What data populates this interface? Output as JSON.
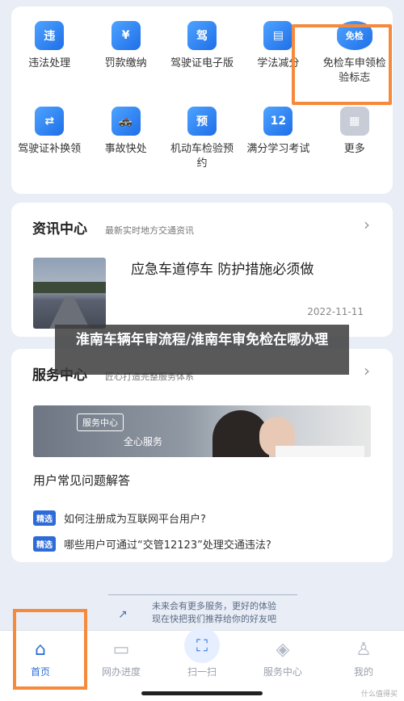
{
  "grid": {
    "items": [
      {
        "label": "违法处理",
        "icon": "violation-icon",
        "glyph": "违"
      },
      {
        "label": "罚款缴纳",
        "icon": "fine-payment-icon",
        "glyph": "¥"
      },
      {
        "label": "驾驶证电子版",
        "icon": "e-license-icon",
        "glyph": "驾"
      },
      {
        "label": "学法减分",
        "icon": "study-book-icon",
        "glyph": "▤"
      },
      {
        "label": "免检车申领检验标志",
        "icon": "exempt-badge-icon",
        "glyph": "免检"
      },
      {
        "label": "驾驶证补换领",
        "icon": "license-replace-icon",
        "glyph": "⇄"
      },
      {
        "label": "事故快处",
        "icon": "accident-car-icon",
        "glyph": "🚓"
      },
      {
        "label": "机动车检验预约",
        "icon": "inspection-booking-icon",
        "glyph": "预"
      },
      {
        "label": "满分学习考试",
        "icon": "calendar-12-icon",
        "glyph": "12"
      },
      {
        "label": "更多",
        "icon": "more-grid-icon",
        "glyph": "▦"
      }
    ]
  },
  "news": {
    "title": "资讯中心",
    "subtitle": "最新实时地方交通资讯",
    "headline": "应急车道停车 防护措施必须做",
    "date": "2022-11-11"
  },
  "caption": {
    "text": "淮南车辆年审流程/淮南年审免检在哪办理"
  },
  "service": {
    "title": "服务中心",
    "subtitle": "匠心打造完整服务体系",
    "banner_tag": "服务中心",
    "banner_text": "全心服务",
    "faq_title": "用户常见问题解答",
    "faq": [
      {
        "tag": "精选",
        "text": "如何注册成为互联网平台用户?"
      },
      {
        "tag": "精选",
        "text": "哪些用户可通过“交管12123”处理交通违法?"
      }
    ]
  },
  "more_note": {
    "line1": "未来会有更多服务，更好的体验",
    "line2": "现在快把我们推荐给你的好友吧"
  },
  "nav": {
    "items": [
      {
        "label": "首页",
        "icon": "home-icon",
        "glyph": "⌂",
        "active": true
      },
      {
        "label": "网办进度",
        "icon": "monitor-icon",
        "glyph": "▭",
        "active": false
      },
      {
        "label": "扫一扫",
        "icon": "scan-icon",
        "glyph": "⛶",
        "active": false
      },
      {
        "label": "服务中心",
        "icon": "service-diamond-icon",
        "glyph": "◈",
        "active": false
      },
      {
        "label": "我的",
        "icon": "user-icon",
        "glyph": "♙",
        "active": false
      }
    ]
  },
  "watermark": "什么值得买"
}
